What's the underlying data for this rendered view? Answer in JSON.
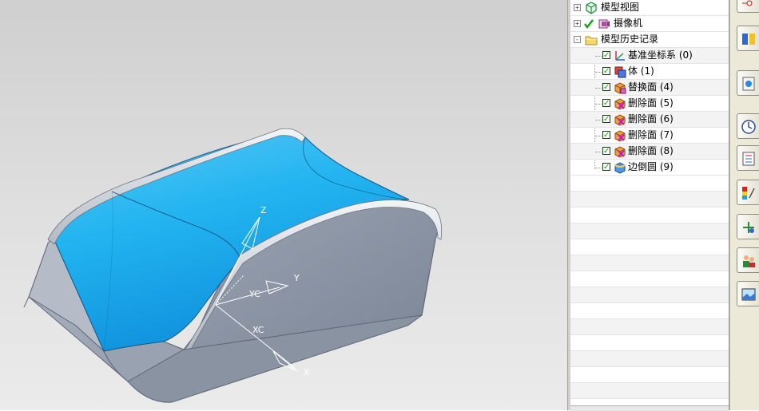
{
  "navigator": {
    "rows": [
      {
        "kind": "group",
        "label": "模型视图",
        "icon": "model-views-icon",
        "expander": "+",
        "checked": false
      },
      {
        "kind": "group",
        "label": "摄像机",
        "icon": "cameras-icon",
        "expander": "+",
        "checked": true
      },
      {
        "kind": "group",
        "label": "模型历史记录",
        "icon": "folder-icon",
        "expander": "-",
        "checked": false
      },
      {
        "kind": "feature",
        "label": "基准坐标系 (0)",
        "icon": "datum-csys-icon",
        "checked": true
      },
      {
        "kind": "feature",
        "label": "体 (1)",
        "icon": "body-icon",
        "checked": true
      },
      {
        "kind": "feature",
        "label": "替换面 (4)",
        "icon": "replace-face-icon",
        "checked": true
      },
      {
        "kind": "feature",
        "label": "删除面 (5)",
        "icon": "delete-face-icon",
        "checked": true
      },
      {
        "kind": "feature",
        "label": "删除面 (6)",
        "icon": "delete-face-icon",
        "checked": true
      },
      {
        "kind": "feature",
        "label": "删除面 (7)",
        "icon": "delete-face-icon",
        "checked": true
      },
      {
        "kind": "feature",
        "label": "删除面 (8)",
        "icon": "delete-face-icon",
        "checked": true
      },
      {
        "kind": "feature",
        "label": "边倒圆 (9)",
        "icon": "edge-blend-icon",
        "checked": true
      }
    ]
  },
  "viewport": {
    "triad": {
      "z": "Z",
      "y": "Y",
      "x": "X",
      "yc": "YC",
      "xc": "XC"
    }
  },
  "resource_bar": {
    "buttons": [
      {
        "name": "assembly-navigator-icon"
      },
      {
        "name": "constraint-navigator-icon"
      },
      {
        "name": "part-navigator-icon"
      },
      {
        "name": "history-icon"
      },
      {
        "name": "reuse-library-icon"
      },
      {
        "name": "analysis-icon"
      },
      {
        "name": "process-studio-icon"
      },
      {
        "name": "roles-icon"
      },
      {
        "name": "system-scene-icon"
      }
    ]
  },
  "colors": {
    "surface_blue": "#1ea8ea",
    "body_gray": "#8e98a8",
    "viewport_bg": "#dcdcdc",
    "check_green": "#14a014"
  }
}
